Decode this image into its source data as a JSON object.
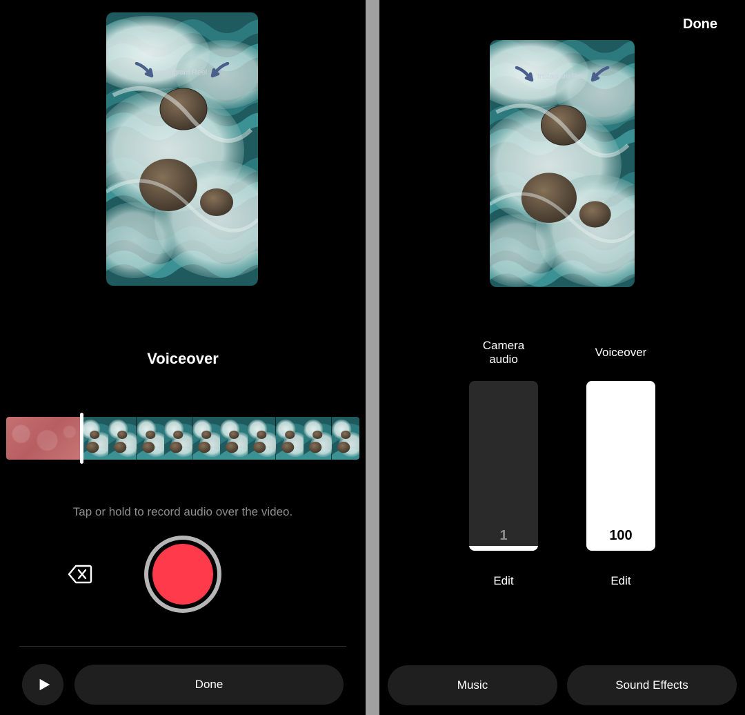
{
  "thumbnail_overlay_text": "Instagram Reel",
  "left": {
    "title": "Voiceover",
    "hint": "Tap or hold to record audio over the video.",
    "done_label": "Done",
    "timeline": {
      "recorded_fraction": 0.21,
      "frame_count": 10
    }
  },
  "right": {
    "done_label": "Done",
    "bottom_buttons": {
      "music": "Music",
      "sound_effects": "Sound Effects"
    },
    "mixer": {
      "camera": {
        "label": "Camera\naudio",
        "value": 1,
        "edit": "Edit"
      },
      "voiceover": {
        "label": "Voiceover",
        "value": 100,
        "edit": "Edit"
      }
    }
  },
  "icons": {
    "arrow_left": "arrow-down-left-icon",
    "arrow_right": "arrow-down-right-icon",
    "delete": "delete-back-icon",
    "play": "play-icon",
    "record": "record-icon"
  }
}
